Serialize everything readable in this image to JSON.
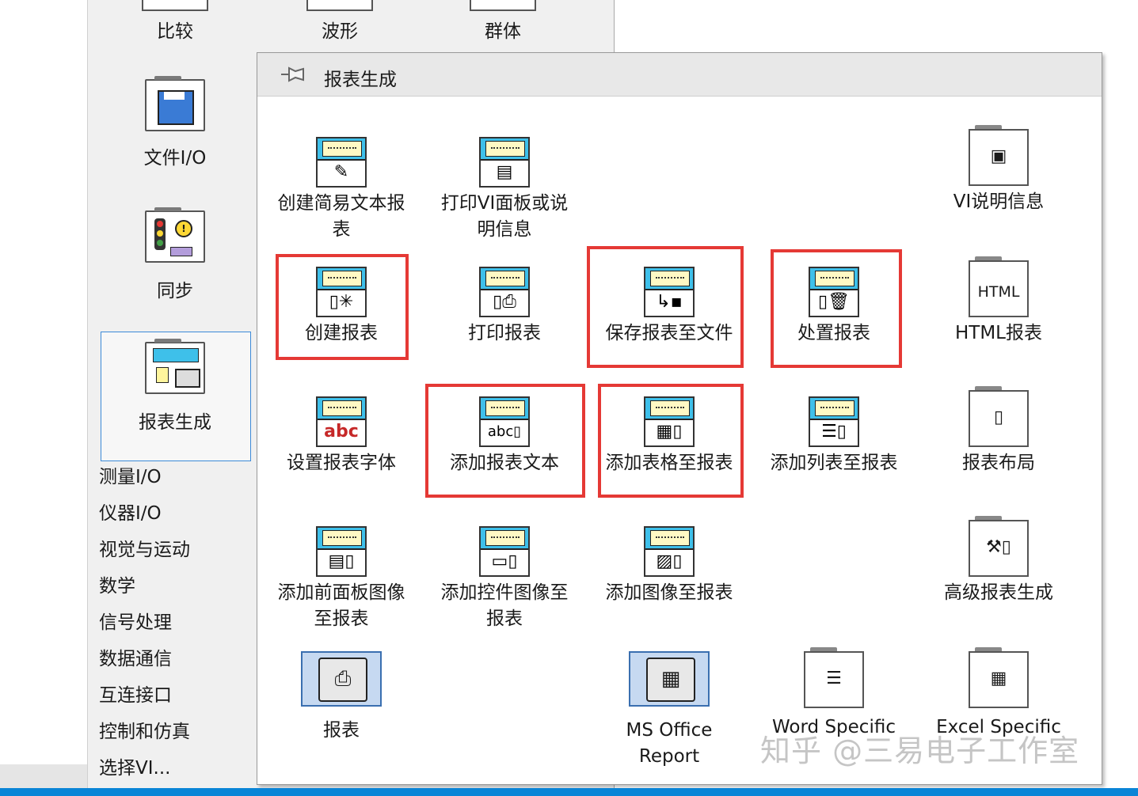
{
  "back_palette": {
    "top_row": [
      "比较",
      "波形",
      "群体"
    ],
    "items": [
      {
        "label": "文件I/O",
        "icon": "floppy-disk-icon"
      },
      {
        "label": "同步",
        "icon": "traffic-light-icon"
      },
      {
        "label": "报表生成",
        "icon": "report-printer-icon"
      }
    ],
    "text_items": [
      "测量I/O",
      "仪器I/O",
      "视觉与运动",
      "数学",
      "信号处理",
      "数据通信",
      "互连接口",
      "控制和仿真",
      "选择VI..."
    ]
  },
  "report_palette": {
    "title": "报表生成",
    "cells": [
      {
        "label": "创建简易文本报表",
        "sym": "✎"
      },
      {
        "label": "打印VI面板或说明信息",
        "sym": "▤"
      },
      {
        "label": "VI说明信息",
        "sym": "▣"
      },
      {
        "label": "创建报表",
        "sym": "▯✳"
      },
      {
        "label": "打印报表",
        "sym": "▯⎙"
      },
      {
        "label": "保存报表至文件",
        "sym": "↳▪"
      },
      {
        "label": "处置报表",
        "sym": "▯🗑"
      },
      {
        "label": "HTML报表",
        "sym": "HTML"
      },
      {
        "label": "设置报表字体",
        "sym": "abc"
      },
      {
        "label": "添加报表文本",
        "sym": "abc▯"
      },
      {
        "label": "添加表格至报表",
        "sym": "▦▯"
      },
      {
        "label": "添加列表至报表",
        "sym": "☰▯"
      },
      {
        "label": "报表布局",
        "sym": "▯"
      },
      {
        "label": "添加前面板图像至报表",
        "sym": "▤▯"
      },
      {
        "label": "添加控件图像至报表",
        "sym": "▭▯"
      },
      {
        "label": "添加图像至报表",
        "sym": "▨▯"
      },
      {
        "label": "高级报表生成",
        "sym": "⚒▯"
      },
      {
        "label": "报表",
        "sym": "⎙"
      },
      {
        "label": "MS Office Report",
        "sym": "▦"
      },
      {
        "label": "Word Specific",
        "sym": "☰"
      },
      {
        "label": "Excel Specific",
        "sym": "▦"
      }
    ]
  },
  "watermark": "知乎 @三易电子工作室",
  "colors": {
    "highlight": "#e53935",
    "icon_header": "#3ec0ea",
    "selection": "#3c8ad8"
  }
}
